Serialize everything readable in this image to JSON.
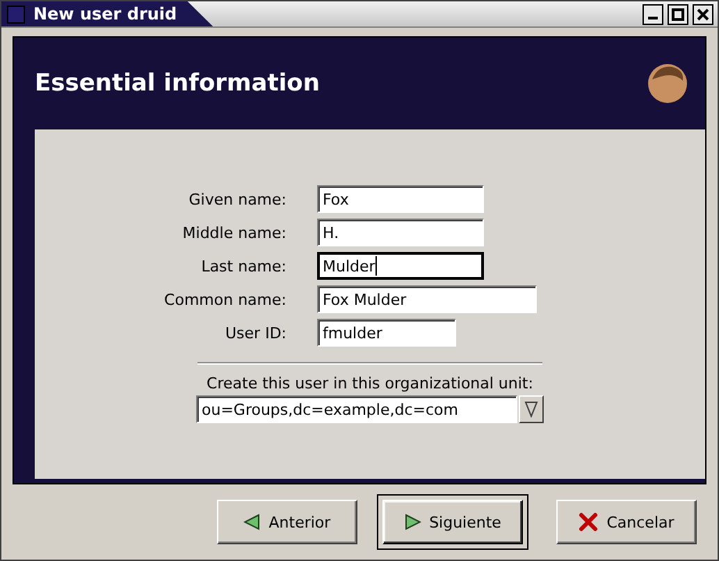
{
  "window": {
    "title": "New user druid"
  },
  "header": {
    "title": "Essential information"
  },
  "fields": [
    {
      "label": "Given name:",
      "value": "Fox",
      "focused": false
    },
    {
      "label": "Middle name:",
      "value": "H.",
      "focused": false
    },
    {
      "label": "Last name:",
      "value": "Mulder",
      "focused": true
    },
    {
      "label": "Common name:",
      "value": "Fox Mulder",
      "focused": false
    },
    {
      "label": "User ID:",
      "value": "fmulder",
      "focused": false
    }
  ],
  "ou": {
    "label": "Create this user in this organizational unit:",
    "value": "ou=Groups,dc=example,dc=com"
  },
  "buttons": [
    {
      "label": "Anterior",
      "kind": "back",
      "default": false
    },
    {
      "label": "Siguiente",
      "kind": "next",
      "default": true
    },
    {
      "label": "Cancelar",
      "kind": "cancel",
      "default": false
    }
  ]
}
